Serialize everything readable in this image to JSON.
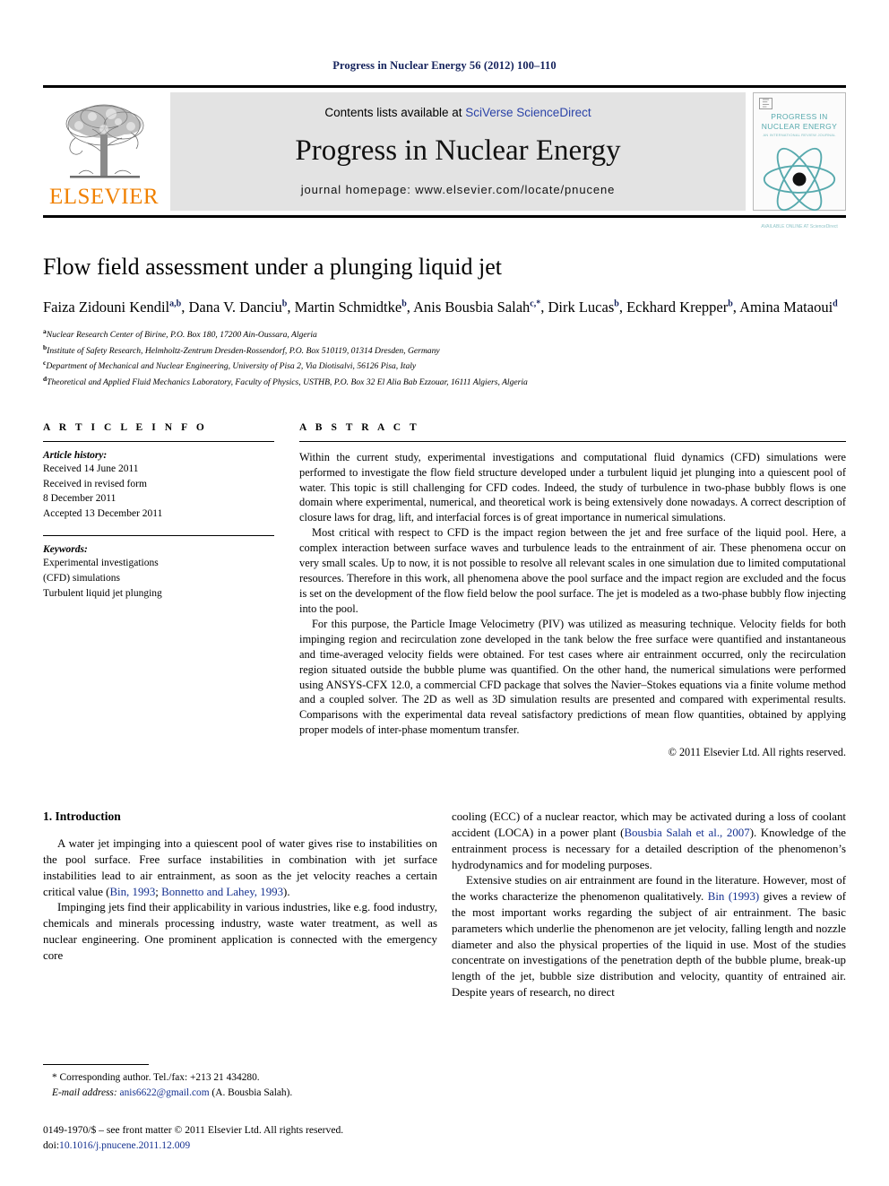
{
  "running_head": "Progress in Nuclear Energy 56 (2012) 100–110",
  "masthead": {
    "contents_prefix": "Contents lists available at ",
    "contents_link": "SciVerse ScienceDirect",
    "journal_name": "Progress in Nuclear Energy",
    "homepage": "journal homepage: www.elsevier.com/locate/pnucene",
    "publisher_wordmark": "ELSEVIER",
    "publisher_color": "#F08000",
    "link_color": "#2b43a8",
    "cover": {
      "title_line1": "PROGRESS IN",
      "title_line2": "NUCLEAR ENERGY",
      "subtitle": "AN INTERNATIONAL REVIEW JOURNAL",
      "footer": "AVAILABLE ONLINE AT ScienceDirect",
      "accent_color": "#56a9ad"
    }
  },
  "article": {
    "title": "Flow field assessment under a plunging liquid jet",
    "authors": [
      {
        "name": "Faiza Zidouni Kendil",
        "sup": "a,b",
        "sep": ", "
      },
      {
        "name": "Dana V. Danciu",
        "sup": "b",
        "sep": ", "
      },
      {
        "name": "Martin Schmidtke",
        "sup": "b",
        "sep": ", "
      },
      {
        "name": "Anis Bousbia Salah",
        "sup": "c,*",
        "sep": ", "
      },
      {
        "name": "Dirk Lucas",
        "sup": "b",
        "sep": ", "
      },
      {
        "name": "Eckhard Krepper",
        "sup": "b",
        "sep": ", "
      },
      {
        "name": "Amina Mataoui",
        "sup": "d",
        "sep": ""
      }
    ],
    "affiliations": [
      {
        "mark": "a",
        "text": "Nuclear Research Center of Birine, P.O. Box 180, 17200 Ain-Oussara, Algeria"
      },
      {
        "mark": "b",
        "text": "Institute of Safety Research, Helmholtz-Zentrum Dresden-Rossendorf, P.O. Box 510119, 01314 Dresden, Germany"
      },
      {
        "mark": "c",
        "text": "Department of Mechanical and Nuclear Engineering, University of Pisa 2, Via Diotisalvi, 56126 Pisa, Italy"
      },
      {
        "mark": "d",
        "text": "Theoretical and Applied Fluid Mechanics Laboratory, Faculty of Physics, USTHB, P.O. Box 32 El Alia Bab Ezzouar, 16111 Algiers, Algeria"
      }
    ]
  },
  "article_info": {
    "heading": "A R T I C L E   I N F O",
    "history_label": "Article history:",
    "history": [
      "Received 14 June 2011",
      "Received in revised form",
      "8 December 2011",
      "Accepted 13 December 2011"
    ],
    "keywords_label": "Keywords:",
    "keywords": [
      "Experimental investigations",
      "(CFD) simulations",
      "Turbulent liquid jet plunging"
    ]
  },
  "abstract": {
    "heading": "A B S T R A C T",
    "paragraphs": [
      "Within the current study, experimental investigations and computational fluid dynamics (CFD) simulations were performed to investigate the flow field structure developed under a turbulent liquid jet plunging into a quiescent pool of water. This topic is still challenging for CFD codes. Indeed, the study of turbulence in two-phase bubbly flows is one domain where experimental, numerical, and theoretical work is being extensively done nowadays. A correct description of closure laws for drag, lift, and interfacial forces is of great importance in numerical simulations.",
      "Most critical with respect to CFD is the impact region between the jet and free surface of the liquid pool. Here, a complex interaction between surface waves and turbulence leads to the entrainment of air. These phenomena occur on very small scales. Up to now, it is not possible to resolve all relevant scales in one simulation due to limited computational resources. Therefore in this work, all phenomena above the pool surface and the impact region are excluded and the focus is set on the development of the flow field below the pool surface. The jet is modeled as a two-phase bubbly flow injecting into the pool.",
      "For this purpose, the Particle Image Velocimetry (PIV) was utilized as measuring technique. Velocity fields for both impinging region and recirculation zone developed in the tank below the free surface were quantified and instantaneous and time-averaged velocity fields were obtained. For test cases where air entrainment occurred, only the recirculation region situated outside the bubble plume was quantified. On the other hand, the numerical simulations were performed using ANSYS-CFX 12.0, a commercial CFD package that solves the Navier–Stokes equations via a finite volume method and a coupled solver. The 2D as well as 3D simulation results are presented and compared with experimental results. Comparisons with the experimental data reveal satisfactory predictions of mean flow quantities, obtained by applying proper models of inter-phase momentum transfer."
    ],
    "copyright": "© 2011 Elsevier Ltd. All rights reserved."
  },
  "introduction": {
    "heading": "1. Introduction",
    "left": {
      "p1_a": "A water jet impinging into a quiescent pool of water gives rise to instabilities on the pool surface. Free surface instabilities in combination with jet surface instabilities lead to air entrainment, as soon as the jet velocity reaches a certain critical value (",
      "p1_cite1": "Bin, 1993",
      "p1_b": "; ",
      "p1_cite2": "Bonnetto and Lahey, 1993",
      "p1_c": ").",
      "p2": "Impinging jets find their applicability in various industries, like e.g. food industry, chemicals and minerals processing industry, waste water treatment, as well as nuclear engineering. One prominent application is connected with the emergency core"
    },
    "right": {
      "p1_a": "cooling (ECC) of a nuclear reactor, which may be activated during a loss of coolant accident (LOCA) in a power plant (",
      "p1_cite": "Bousbia Salah et al., 2007",
      "p1_b": "). Knowledge of the entrainment process is necessary for a detailed description of the phenomenon’s hydrodynamics and for modeling purposes.",
      "p2_a": "Extensive studies on air entrainment are found in the literature. However, most of the works characterize the phenomenon qualitatively. ",
      "p2_cite": "Bin (1993)",
      "p2_b": " gives a review of the most important works regarding the subject of air entrainment. The basic parameters which underlie the phenomenon are jet velocity, falling length and nozzle diameter and also the physical properties of the liquid in use. Most of the studies concentrate on investigations of the penetration depth of the bubble plume, break-up length of the jet, bubble size distribution and velocity, quantity of entrained air. Despite years of research, no direct"
    }
  },
  "footnote": {
    "corresponding": "* Corresponding author. Tel./fax: +213 21 434280.",
    "email_label": "E-mail address:",
    "email": "anis6622@gmail.com",
    "email_owner": "(A. Bousbia Salah).",
    "issn_line": "0149-1970/$ – see front matter © 2011 Elsevier Ltd. All rights reserved.",
    "doi_label": "doi:",
    "doi": "10.1016/j.pnucene.2011.12.009",
    "link_color": "#14308f"
  }
}
